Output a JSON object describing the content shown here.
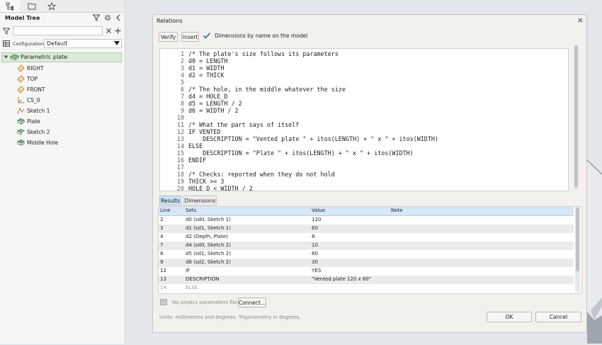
{
  "tree_panel": {
    "title": "Model Tree",
    "filter_value": "",
    "config_label": "Configuration",
    "config_value": "Default",
    "root": "Parametric plate",
    "items": [
      {
        "label": "RIGHT",
        "icon": "datum-plane-icon"
      },
      {
        "label": "TOP",
        "icon": "datum-plane-icon"
      },
      {
        "label": "FRONT",
        "icon": "datum-plane-icon"
      },
      {
        "label": "CS_0",
        "icon": "coordinate-system-icon"
      },
      {
        "label": "Sketch 1",
        "icon": "sketch-icon"
      },
      {
        "label": "Plate",
        "icon": "extrude-icon"
      },
      {
        "label": "Sketch 2",
        "icon": "sketch-icon"
      },
      {
        "label": "Middle Hole",
        "icon": "cut-icon"
      }
    ]
  },
  "dialog": {
    "title": "Relations",
    "verify": "Verify",
    "insert": "Insert",
    "checkbox_label": "Dimensions by name on the model",
    "checkbox_checked": true,
    "line_numbers": [
      "1",
      "2",
      "3",
      "4",
      "5",
      "6",
      "7",
      "8",
      "9",
      "10",
      "11",
      "12",
      "13",
      "14",
      "15",
      "16",
      "17",
      "18",
      "19",
      "20"
    ],
    "code": [
      "/* The plate's size follows its parameters",
      "d0 = LENGTH",
      "d1 = WIDTH",
      "d2 = THICK",
      "",
      "/* The hole, in the middle whatever the size",
      "d4 = HOLE_D",
      "d5 = LENGTH / 2",
      "d6 = WIDTH / 2",
      "",
      "/* What the part says of itself",
      "IF VENTED",
      "    DESCRIPTION = \"Vented plate \" + itos(LENGTH) + \" x \" + itos(WIDTH)",
      "ELSE",
      "    DESCRIPTION = \"Plate \" + itos(LENGTH) + \" x \" + itos(WIDTH)",
      "ENDIF",
      "",
      "/* Checks: reported when they do not hold",
      "THICK >= 3",
      "HOLE_D < WIDTH / 2"
    ],
    "tab_results": "Results",
    "tab_dimensions": "Dimensions",
    "results_headers": [
      "Line",
      "Sets",
      "Value",
      "Note"
    ],
    "results_rows": [
      [
        "2",
        "d0  (sd0, Sketch 1)",
        "120",
        ""
      ],
      [
        "3",
        "d1  (sd1, Sketch 1)",
        "60",
        ""
      ],
      [
        "4",
        "d2  (Depth, Plate)",
        "8",
        ""
      ],
      [
        "7",
        "d4  (sd0, Sketch 2)",
        "10",
        ""
      ],
      [
        "8",
        "d5  (sd1, Sketch 2)",
        "60",
        ""
      ],
      [
        "9",
        "d6  (sd2, Sketch 2)",
        "30",
        ""
      ],
      [
        "12",
        "IF",
        "YES",
        ""
      ],
      [
        "13",
        "DESCRIPTION",
        "\"Vented plate 120 x 60\"",
        ""
      ],
      [
        "14",
        "ELSE",
        "",
        ""
      ]
    ],
    "no_params": "No project parameters file.",
    "connect": "Connect...",
    "units_note": "Units: millimetres and degrees. Trigonometry in degrees.",
    "ok": "OK",
    "cancel": "Cancel"
  },
  "colors": {
    "tree_selected": "#dcebda",
    "results_header": "#d7e7f7",
    "tab_active": "#cfe2f5"
  }
}
